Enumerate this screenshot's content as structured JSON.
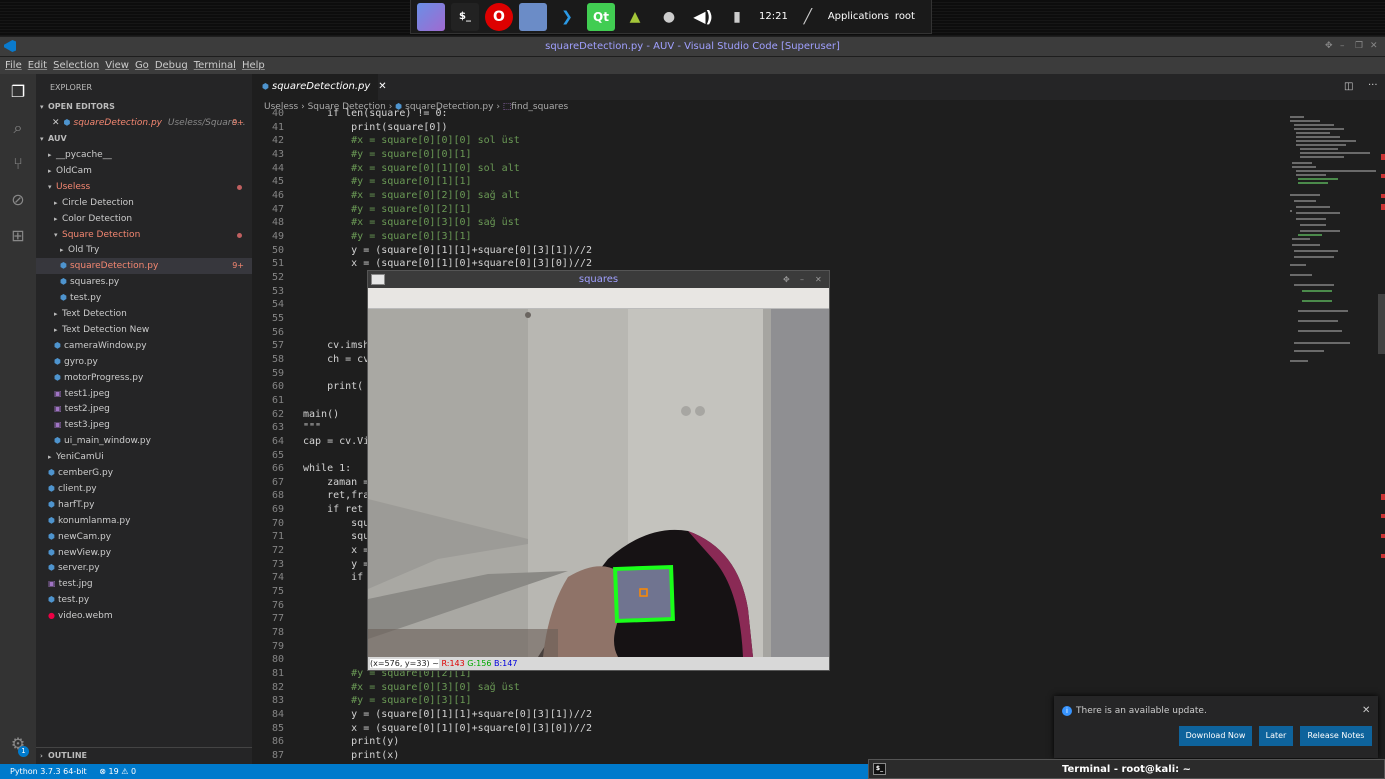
{
  "desktop": {
    "clock": "12:21",
    "applications_label": "Applications",
    "user_label": "root",
    "dock_icons": [
      "files-icon",
      "terminal-icon",
      "opera-icon",
      "folder-icon",
      "vscode-icon",
      "qt-icon",
      "android-icon",
      "alien-icon",
      "volume-icon",
      "battery-icon",
      "kali-icon"
    ]
  },
  "window": {
    "title": "squareDetection.py - AUV - Visual Studio Code [Superuser]"
  },
  "menu": [
    "File",
    "Edit",
    "Selection",
    "View",
    "Go",
    "Debug",
    "Terminal",
    "Help"
  ],
  "sidebar": {
    "explorer_label": "EXPLORER",
    "open_editors_label": "OPEN EDITORS",
    "open_editor": {
      "name": "squareDetection.py",
      "path": "Useless/Square...",
      "badge": "9+"
    },
    "project_label": "AUV",
    "tree": [
      {
        "label": "__pycache__",
        "type": "folder"
      },
      {
        "label": "OldCam",
        "type": "folder"
      },
      {
        "label": "Useless",
        "type": "folder-open"
      },
      {
        "label": "Circle Detection",
        "type": "folder"
      },
      {
        "label": "Color Detection",
        "type": "folder"
      },
      {
        "label": "Square Detection",
        "type": "folder-open"
      },
      {
        "label": "Old Try",
        "type": "folder"
      },
      {
        "label": "squareDetection.py",
        "type": "py",
        "badge": "9+"
      },
      {
        "label": "squares.py",
        "type": "py"
      },
      {
        "label": "test.py",
        "type": "py"
      },
      {
        "label": "Text Detection",
        "type": "folder"
      },
      {
        "label": "Text Detection New",
        "type": "folder"
      },
      {
        "label": "cameraWindow.py",
        "type": "py"
      },
      {
        "label": "gyro.py",
        "type": "py"
      },
      {
        "label": "motorProgress.py",
        "type": "py"
      },
      {
        "label": "test1.jpeg",
        "type": "img"
      },
      {
        "label": "test2.jpeg",
        "type": "img"
      },
      {
        "label": "test3.jpeg",
        "type": "img"
      },
      {
        "label": "ui_main_window.py",
        "type": "py"
      },
      {
        "label": "YeniCamUi",
        "type": "folder"
      },
      {
        "label": "cemberG.py",
        "type": "py"
      },
      {
        "label": "client.py",
        "type": "py"
      },
      {
        "label": "harfT.py",
        "type": "py"
      },
      {
        "label": "konumlanma.py",
        "type": "py"
      },
      {
        "label": "newCam.py",
        "type": "py"
      },
      {
        "label": "newView.py",
        "type": "py"
      },
      {
        "label": "server.py",
        "type": "py"
      },
      {
        "label": "test.jpg",
        "type": "img"
      },
      {
        "label": "test.py",
        "type": "py"
      },
      {
        "label": "video.webm",
        "type": "vid"
      }
    ],
    "outline_label": "OUTLINE",
    "settings_badge": "1"
  },
  "editor": {
    "tab_label": "squareDetection.py",
    "breadcrumb": [
      "Useless",
      "Square Detection",
      "squareDetection.py",
      "find_squares"
    ],
    "lines": [
      {
        "n": "40",
        "t": "    if len(square) != 0:"
      },
      {
        "n": "41",
        "t": "        print(square[0])"
      },
      {
        "n": "42",
        "t": "        #x = square[0][0][0] sol üst"
      },
      {
        "n": "43",
        "t": "        #y = square[0][0][1]"
      },
      {
        "n": "44",
        "t": "        #x = square[0][1][0] sol alt"
      },
      {
        "n": "45",
        "t": "        #y = square[0][1][1]"
      },
      {
        "n": "46",
        "t": "        #x = square[0][2][0] sağ alt"
      },
      {
        "n": "47",
        "t": "        #y = square[0][2][1]"
      },
      {
        "n": "48",
        "t": "        #x = square[0][3][0] sağ üst"
      },
      {
        "n": "49",
        "t": "        #y = square[0][3][1]"
      },
      {
        "n": "50",
        "t": "        y = (square[0][1][1]+square[0][3][1])//2"
      },
      {
        "n": "51",
        "t": "        x = (square[0][1][0]+square[0][3][0])//2"
      },
      {
        "n": "52",
        "t": ""
      },
      {
        "n": "53",
        "t": ""
      },
      {
        "n": "54",
        "t": ""
      },
      {
        "n": "55",
        "t": ""
      },
      {
        "n": "56",
        "t": ""
      },
      {
        "n": "57",
        "t": "    cv.imsh"
      },
      {
        "n": "58",
        "t": "    ch = cv"
      },
      {
        "n": "59",
        "t": ""
      },
      {
        "n": "60",
        "t": "    print("
      },
      {
        "n": "61",
        "t": ""
      },
      {
        "n": "62",
        "t": "main()"
      },
      {
        "n": "63",
        "t": "\"\"\""
      },
      {
        "n": "64",
        "t": "cap = cv.Vi"
      },
      {
        "n": "65",
        "t": ""
      },
      {
        "n": "66",
        "t": "while 1:"
      },
      {
        "n": "67",
        "t": "    zaman ="
      },
      {
        "n": "68",
        "t": "    ret,fra"
      },
      {
        "n": "69",
        "t": "    if ret"
      },
      {
        "n": "70",
        "t": "        squ"
      },
      {
        "n": "71",
        "t": "        squ"
      },
      {
        "n": "72",
        "t": "        x ="
      },
      {
        "n": "73",
        "t": "        y ="
      },
      {
        "n": "74",
        "t": "        if"
      },
      {
        "n": "75",
        "t": ""
      },
      {
        "n": "76",
        "t": ""
      },
      {
        "n": "77",
        "t": ""
      },
      {
        "n": "78",
        "t": ""
      },
      {
        "n": "79",
        "t": ""
      },
      {
        "n": "80",
        "t": ""
      },
      {
        "n": "81",
        "t": "        #y = square[0][2][1]"
      },
      {
        "n": "82",
        "t": "        #x = square[0][3][0] sağ üst"
      },
      {
        "n": "83",
        "t": "        #y = square[0][3][1]"
      },
      {
        "n": "84",
        "t": "        y = (square[0][1][1]+square[0][3][1])//2"
      },
      {
        "n": "85",
        "t": "        x = (square[0][1][0]+square[0][3][0])//2"
      },
      {
        "n": "86",
        "t": "        print(y)"
      },
      {
        "n": "87",
        "t": "        print(x)"
      }
    ]
  },
  "squares_window": {
    "title": "squares",
    "status_coords": "(x=576, y=33) ~",
    "r": "R:143",
    "g": "G:156",
    "b": "B:147"
  },
  "notification": {
    "message": "There is an available update.",
    "buttons": [
      "Download Now",
      "Later",
      "Release Notes"
    ]
  },
  "statusbar": {
    "python": "Python 3.7.3 64-bit",
    "errors": "19",
    "warnings": "0"
  },
  "terminal": {
    "title": "Terminal - root@kali: ~"
  }
}
